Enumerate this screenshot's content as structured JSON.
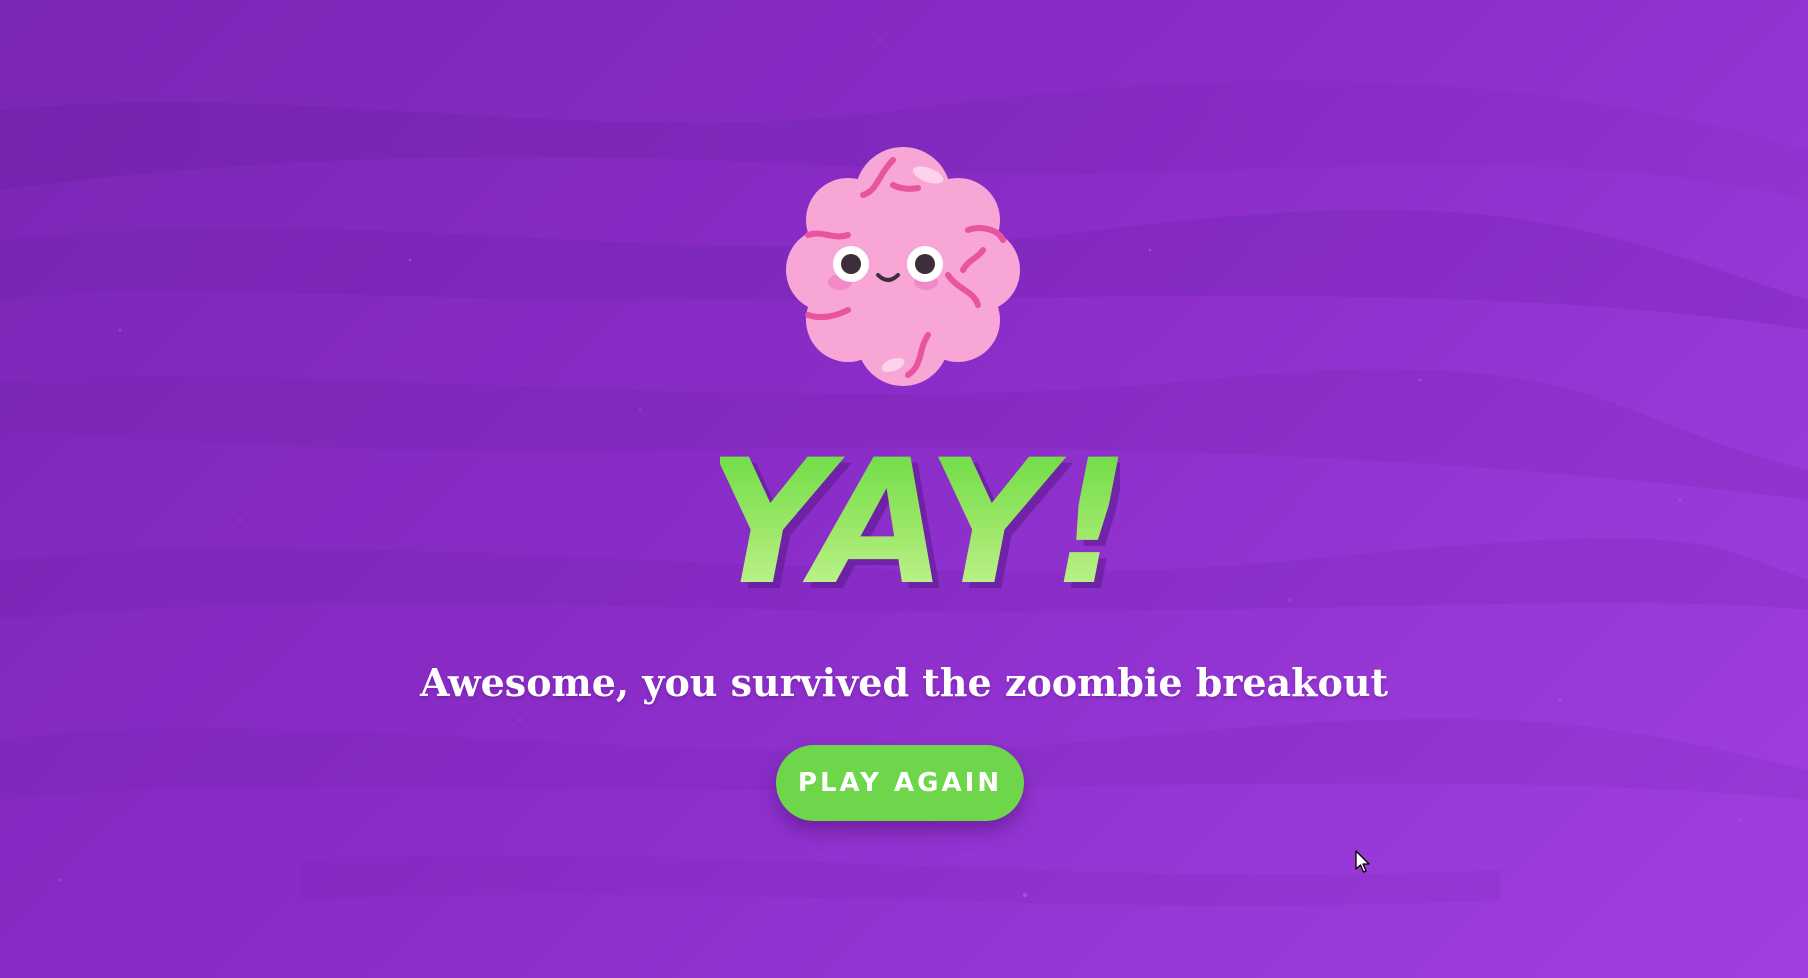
{
  "screen": {
    "headline": "YAY!",
    "message": "Awesome, you survived the zoombie breakout",
    "play_again_label": "PLAY AGAIN"
  },
  "mascot": {
    "icon": "smiling-brain-icon"
  },
  "colors": {
    "background": "#8a2cc7",
    "headline_green": "#6fdc3e",
    "button_green": "#6ed64a",
    "brain_pink": "#f59bd0",
    "text_white": "#ffffff"
  }
}
